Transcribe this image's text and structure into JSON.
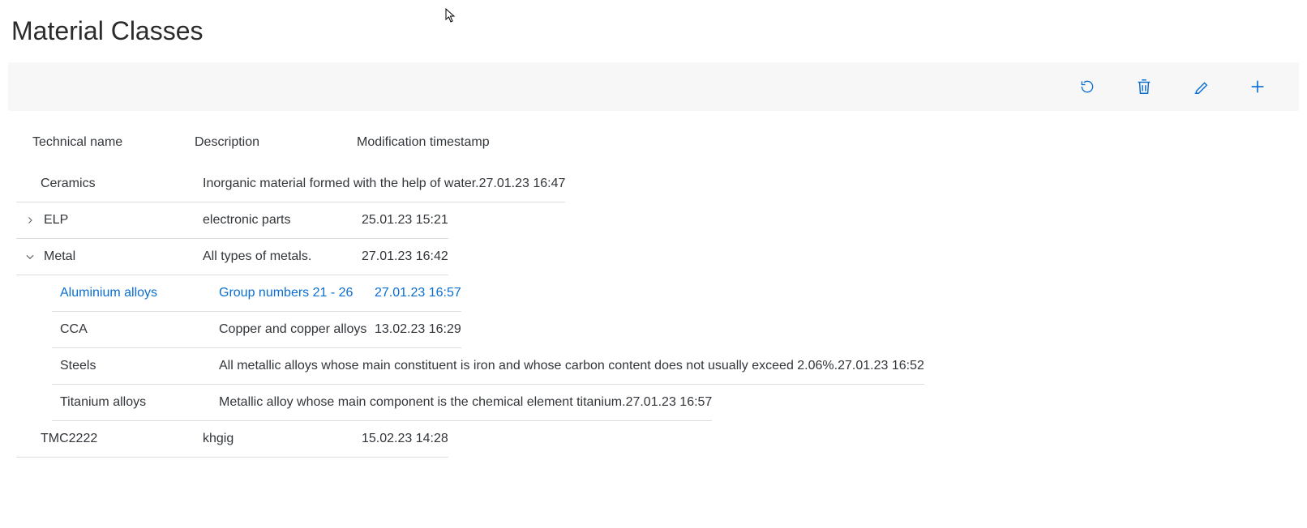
{
  "page": {
    "title": "Material Classes"
  },
  "toolbar": {
    "refresh_name": "refresh",
    "delete_name": "delete",
    "edit_name": "edit",
    "add_name": "add"
  },
  "columns": {
    "name": "Technical name",
    "description": "Description",
    "timestamp": "Modification timestamp"
  },
  "rows": {
    "ceramics": {
      "name": "Ceramics",
      "description": "Inorganic material formed with the help of water.",
      "timestamp": "27.01.23 16:47"
    },
    "elp": {
      "name": "ELP",
      "description": "electronic parts",
      "timestamp": "25.01.23 15:21"
    },
    "metal": {
      "name": "Metal",
      "description": "All types of metals.",
      "timestamp": "27.01.23 16:42"
    },
    "tmc2222": {
      "name": "TMC2222",
      "description": "khgig",
      "timestamp": "15.02.23 14:28"
    }
  },
  "metal_children": {
    "aluminium": {
      "name": "Aluminium alloys",
      "description": "Group numbers 21 - 26",
      "timestamp": "27.01.23 16:57"
    },
    "cca": {
      "name": "CCA",
      "description": "Copper and copper alloys",
      "timestamp": "13.02.23 16:29"
    },
    "steels": {
      "name": "Steels",
      "description": "All metallic alloys whose main constituent is iron and whose carbon content does not usually exceed 2.06%.",
      "timestamp": "27.01.23 16:52"
    },
    "titanium": {
      "name": "Titanium alloys",
      "description": "Metallic alloy whose main component is the chemical element titanium.",
      "timestamp": "27.01.23 16:57"
    }
  }
}
